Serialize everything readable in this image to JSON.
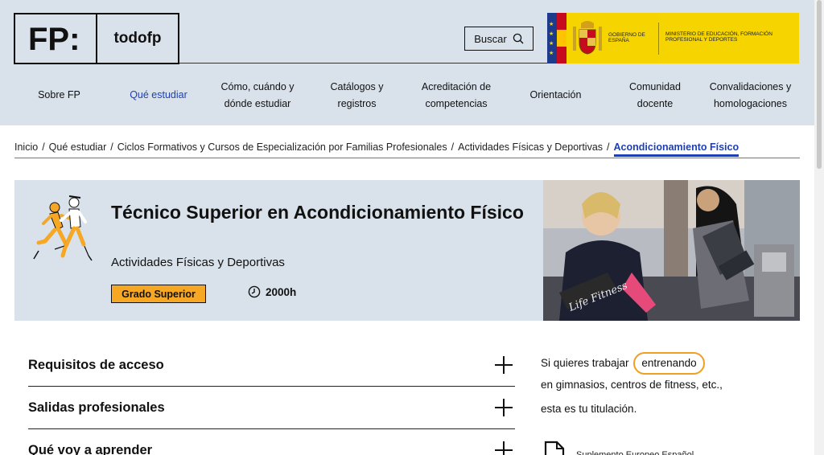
{
  "header": {
    "logo_mark": "FP:",
    "logo_name": "todofp",
    "search_label": "Buscar",
    "gov_block": {
      "line1": "GOBIERNO DE ESPAÑA",
      "line2": "MINISTERIO DE EDUCACIÓN, FORMACIÓN PROFESIONAL Y DEPORTES"
    },
    "colors": {
      "header_bg": "#d9e2ea",
      "gov_yellow": "#f5d400",
      "accent_blue": "#1d3fb3"
    }
  },
  "nav": {
    "items": [
      {
        "label": "Sobre FP"
      },
      {
        "label": "Qué estudiar",
        "active": true
      },
      {
        "label1": "Cómo, cuándo y",
        "label2": "dónde estudiar"
      },
      {
        "label1": "Catálogos y",
        "label2": "registros"
      },
      {
        "label1": "Acreditación de",
        "label2": "competencias"
      },
      {
        "label": "Orientación"
      },
      {
        "label1": "Comunidad",
        "label2": "docente"
      },
      {
        "label1": "Convalidaciones y",
        "label2": "homologaciones"
      }
    ]
  },
  "breadcrumb": {
    "items": [
      "Inicio",
      "Qué estudiar",
      "Ciclos Formativos y Cursos de Especialización por Familias Profesionales",
      "Actividades Físicas y Deportivas"
    ],
    "current": "Acondicionamiento Físico",
    "separator": "/"
  },
  "hero": {
    "title": "Técnico Superior en Acondicionamiento Físico",
    "family": "Actividades Físicas y Deportivas",
    "badge": "Grado Superior",
    "hours": "2000h",
    "illustration_icon": "runners-illustration",
    "badge_color": "#f6a723"
  },
  "accordion": {
    "items": [
      {
        "label": "Requisitos de acceso"
      },
      {
        "label": "Salidas profesionales"
      },
      {
        "label": "Qué voy a aprender"
      }
    ]
  },
  "side": {
    "line1_before": "Si quieres trabajar",
    "line1_highlight": "entrenando",
    "line2": "en gimnasios, centros de fitness, etc.,",
    "line3": "esta es tu titulación.",
    "doc_label": "Suplemento Europeo Español"
  }
}
